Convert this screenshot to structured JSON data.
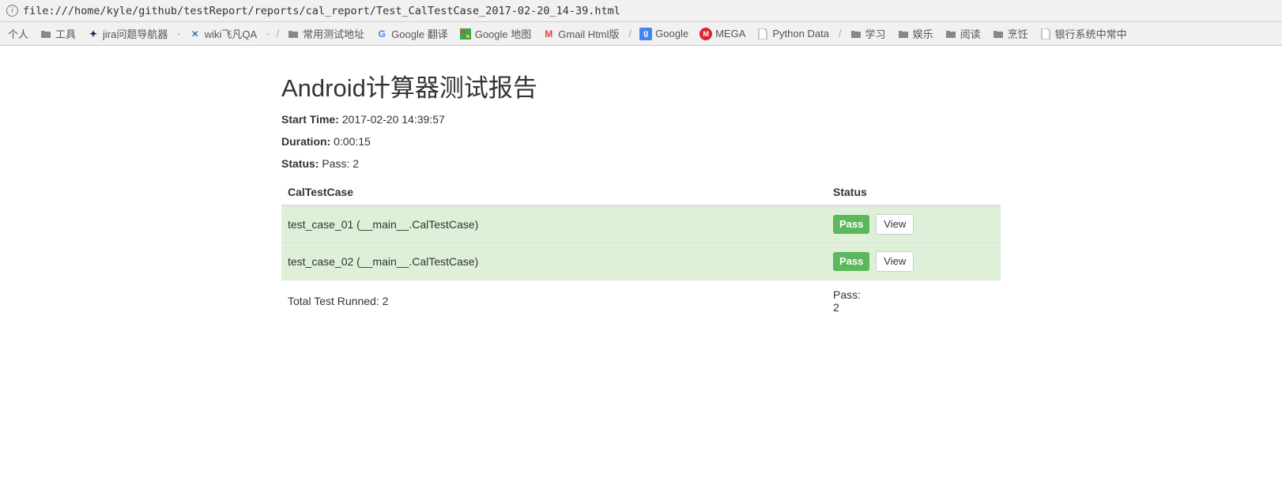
{
  "address_bar": {
    "url": "file:///home/kyle/github/testReport/reports/cal_report/Test_CalTestCase_2017-02-20_14-39.html"
  },
  "bookmarks": {
    "personal": "个人",
    "tools": "工具",
    "jira": "jira问题导航器",
    "wiki": "wiki飞凡QA",
    "test_addr": "常用测试地址",
    "g_translate": "Google 翻译",
    "g_maps": "Google 地图",
    "gmail": "Gmail Html版",
    "google": "Google",
    "mega": "MEGA",
    "python_data": "Python Data",
    "study": "学习",
    "entertain": "娱乐",
    "read": "阅读",
    "cook": "烹饪",
    "bank": "银行系统中常中"
  },
  "report": {
    "title": "Android计算器测试报告",
    "start_label": "Start Time:",
    "start_value": "2017-02-20 14:39:57",
    "duration_label": "Duration:",
    "duration_value": "0:00:15",
    "status_label": "Status:",
    "status_value": "Pass: 2",
    "th_case": "CalTestCase",
    "th_status": "Status",
    "rows": [
      {
        "name": "test_case_01 (__main__.CalTestCase)",
        "status": "Pass",
        "view": "View"
      },
      {
        "name": "test_case_02 (__main__.CalTestCase)",
        "status": "Pass",
        "view": "View"
      }
    ],
    "footer_total": "Total Test Runned: 2",
    "footer_pass_label": "Pass:",
    "footer_pass_value": "2"
  }
}
